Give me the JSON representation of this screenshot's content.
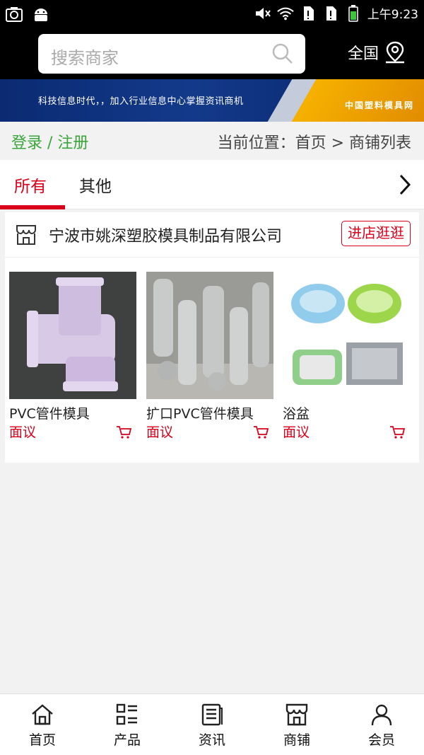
{
  "status_bar": {
    "time": "上午9:23"
  },
  "header": {
    "search_placeholder": "搜索商家",
    "region": "全国"
  },
  "banner": {
    "slogan": "科技信息时代，，加入行业信息中心掌握资讯商机",
    "brand": "中国塑料模具网"
  },
  "location": {
    "login": "登录 / 注册",
    "breadcrumb": "当前位置：首页 > 商铺列表"
  },
  "tabs": [
    {
      "label": "所有",
      "active": true
    },
    {
      "label": "其他",
      "active": false
    }
  ],
  "shop": {
    "name": "宁波市姚深塑胶模具制品有限公司",
    "visit_label": "进店逛逛",
    "products": [
      {
        "name": "PVC管件模具",
        "price": "面议"
      },
      {
        "name": "扩口PVC管件模具",
        "price": "面议"
      },
      {
        "name": "浴盆",
        "price": "面议"
      }
    ]
  },
  "tabbar": [
    {
      "label": "首页"
    },
    {
      "label": "产品"
    },
    {
      "label": "资讯"
    },
    {
      "label": "商铺"
    },
    {
      "label": "会员"
    }
  ],
  "colors": {
    "accent": "#d9001b",
    "login_green": "#3aa53a",
    "header_bg": "#000000"
  }
}
